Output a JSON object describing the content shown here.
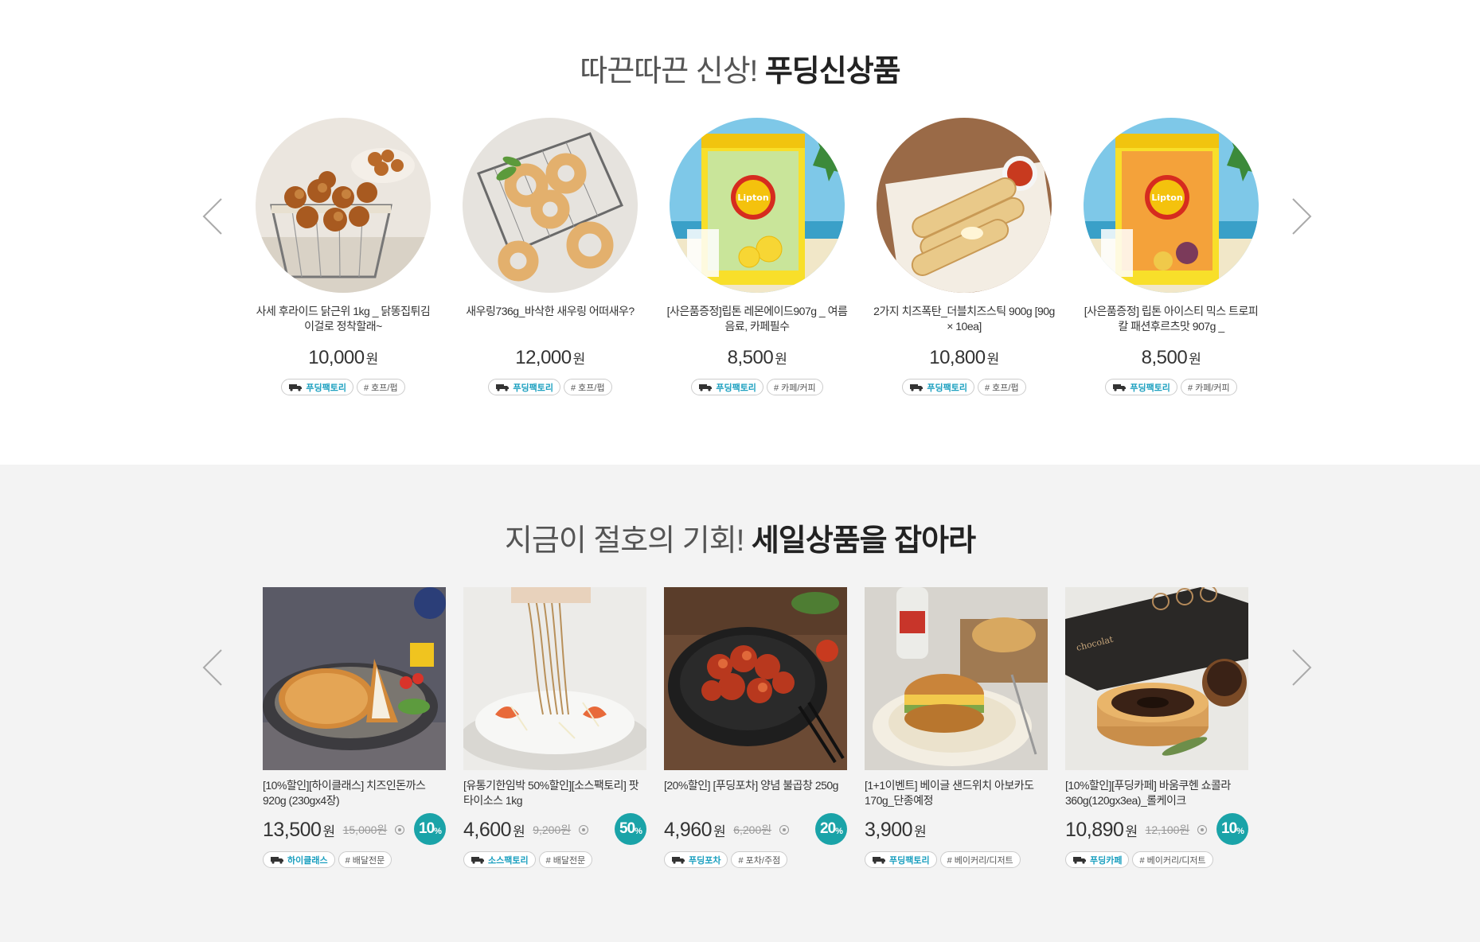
{
  "new_section": {
    "title_light": "따끈따끈 신상!",
    "title_bold": "푸딩신상품",
    "items": [
      {
        "name": "사세 후라이드 닭근위 1kg _ 닭똥집튀김 이걸로 정착할래~",
        "price": "10,000",
        "won": "원",
        "brand": "푸딩팩토리",
        "category": "# 호프/펍"
      },
      {
        "name": "새우링736g_바삭한 새우링 어떠새우?",
        "price": "12,000",
        "won": "원",
        "brand": "푸딩팩토리",
        "category": "# 호프/펍"
      },
      {
        "name": "[사은품증정]립톤 레몬에이드907g _ 여름음료, 카페필수",
        "price": "8,500",
        "won": "원",
        "brand": "푸딩팩토리",
        "category": "# 카페/커피"
      },
      {
        "name": "2가지 치즈폭탄_더블치즈스틱 900g [90g × 10ea]",
        "price": "10,800",
        "won": "원",
        "brand": "푸딩팩토리",
        "category": "# 호프/펍"
      },
      {
        "name": "[사은품증정] 립톤 아이스티 믹스 트로피칼 패션후르츠맛 907g _",
        "price": "8,500",
        "won": "원",
        "brand": "푸딩팩토리",
        "category": "# 카페/커피"
      }
    ]
  },
  "sale_section": {
    "title_light": "지금이 절호의 기회!",
    "title_bold": "세일상품을 잡아라",
    "items": [
      {
        "name": "[10%할인][하이클래스] 치즈인돈까스 920g (230gx4장)",
        "price": "13,500",
        "won": "원",
        "orig": "15,000원",
        "discount": "10",
        "pct": "%",
        "brand": "하이클래스",
        "category": "# 배달전문"
      },
      {
        "name": "[유통기한임박 50%할인][소스팩토리] 팟타이소스 1kg",
        "price": "4,600",
        "won": "원",
        "orig": "9,200원",
        "discount": "50",
        "pct": "%",
        "brand": "소스팩토리",
        "category": "# 배달전문"
      },
      {
        "name": "[20%할인] [푸딩포차] 양념 불곱창 250g",
        "price": "4,960",
        "won": "원",
        "orig": "6,200원",
        "discount": "20",
        "pct": "%",
        "brand": "푸딩포차",
        "category": "# 포차/주점"
      },
      {
        "name": "[1+1이벤트] 베이글 샌드위치 아보카도 170g_단종예정",
        "price": "3,900",
        "won": "원",
        "orig": "",
        "discount": "",
        "pct": "",
        "brand": "푸딩팩토리",
        "category": "# 베이커리/디저트"
      },
      {
        "name": "[10%할인][푸딩카페] 바움쿠헨 쇼콜라 360g(120gx3ea)_롤케이크",
        "price": "10,890",
        "won": "원",
        "orig": "12,100원",
        "discount": "10",
        "pct": "%",
        "brand": "푸딩카페",
        "category": "# 베이커리/디저트"
      }
    ]
  },
  "icons": {
    "prev": "chevron-left-icon",
    "next": "chevron-right-icon",
    "brand": "truck-icon"
  },
  "colors": {
    "accent": "#1aa3a8",
    "brand_text": "#1a9fbf",
    "sale_bg": "#f3f3f3"
  }
}
